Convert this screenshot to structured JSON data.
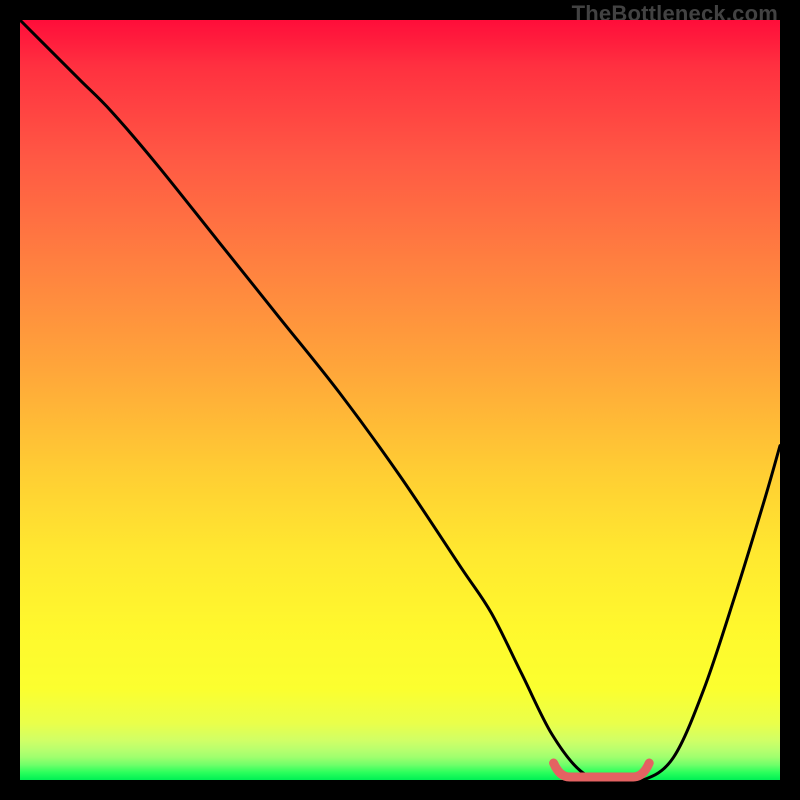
{
  "source_label": "TheBottleneck.com",
  "colors": {
    "bg": "#000000",
    "curve": "#000000",
    "marker": "#e46262",
    "gradient_top": "#ff0d3a",
    "gradient_mid": "#ffe030",
    "gradient_bottom": "#00f055"
  },
  "chart_data": {
    "type": "line",
    "title": "",
    "xlabel": "",
    "ylabel": "",
    "xlim": [
      0,
      100
    ],
    "ylim": [
      0,
      100
    ],
    "grid": false,
    "series": [
      {
        "name": "bottleneck-curve",
        "x": [
          0,
          4,
          8,
          12,
          18,
          26,
          34,
          42,
          50,
          58,
          62,
          66,
          70,
          74,
          78,
          82,
          86,
          90,
          94,
          98,
          100
        ],
        "y": [
          100,
          96,
          92,
          88,
          81,
          71,
          61,
          51,
          40,
          28,
          22,
          14,
          6,
          1,
          0,
          0,
          3,
          12,
          24,
          37,
          44
        ]
      }
    ],
    "annotations": [
      {
        "name": "bottleneck-minimum-band",
        "x_start": 71,
        "x_end": 82,
        "y": 0
      }
    ]
  }
}
